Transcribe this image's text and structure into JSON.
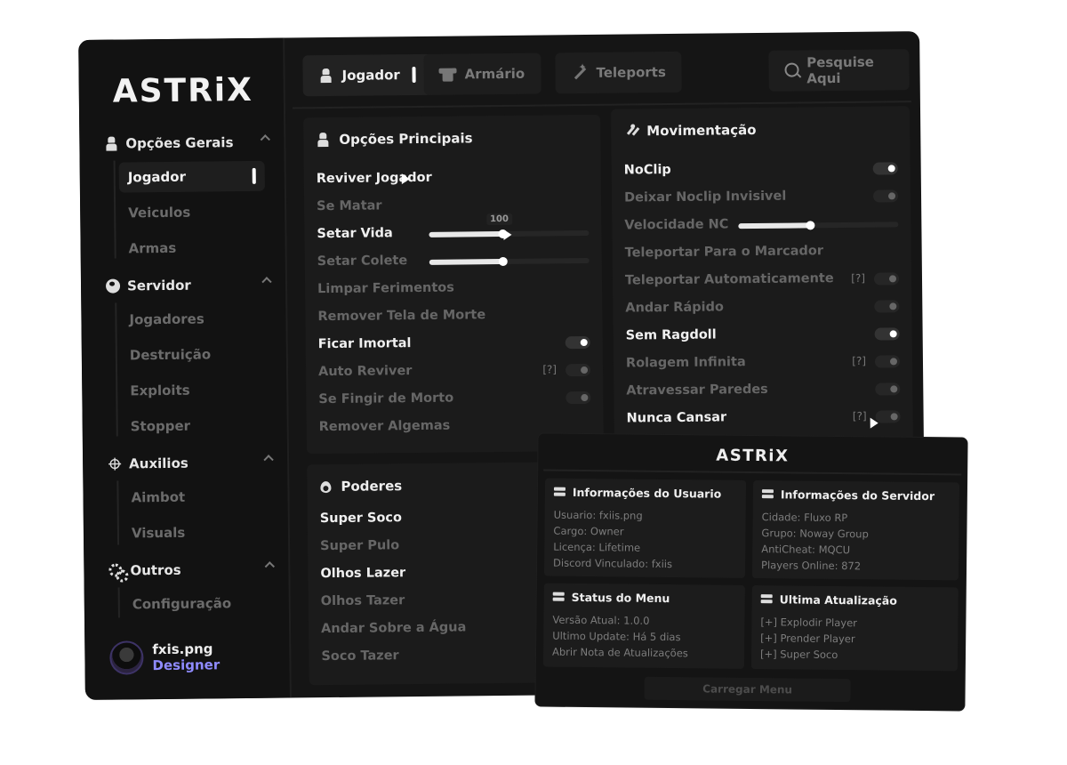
{
  "app": {
    "logo": "ASTRiX"
  },
  "sidebar": {
    "sections": [
      {
        "label": "Opções Gerais",
        "icon": "person-icon",
        "items": [
          "Jogador",
          "Veiculos",
          "Armas"
        ]
      },
      {
        "label": "Servidor",
        "icon": "globe-icon",
        "items": [
          "Jogadores",
          "Destruição",
          "Exploits",
          "Stopper"
        ]
      },
      {
        "label": "Auxilios",
        "icon": "crosshair-icon",
        "items": [
          "Aimbot",
          "Visuals"
        ]
      },
      {
        "label": "Outros",
        "icon": "gears-icon",
        "items": [
          "Configuração"
        ]
      }
    ],
    "active_item": "Jogador",
    "profile": {
      "name": "fxis.png",
      "role": "Designer"
    }
  },
  "tabs": [
    {
      "label": "Jogador",
      "icon": "person-icon",
      "active": true
    },
    {
      "label": "Armário",
      "icon": "shirt-icon",
      "active": false
    },
    {
      "label": "Teleports",
      "icon": "wand-icon",
      "active": false
    }
  ],
  "search": {
    "label": "Pesquise Aqui"
  },
  "panels": {
    "principais": {
      "title": "Opções Principais",
      "rows": [
        {
          "label": "Reviver Jogador",
          "on": true
        },
        {
          "label": "Se Matar",
          "on": false
        },
        {
          "label": "Setar Vida",
          "on": true,
          "slider": 0.46,
          "slider_value": "100"
        },
        {
          "label": "Setar Colete",
          "on": false,
          "slider": 0.46
        },
        {
          "label": "Limpar Ferimentos",
          "on": false
        },
        {
          "label": "Remover Tela de Morte",
          "on": false
        },
        {
          "label": "Ficar Imortal",
          "on": true,
          "toggle": true
        },
        {
          "label": "Auto Reviver",
          "on": false,
          "toggle": false,
          "help": "[?]"
        },
        {
          "label": "Se Fingir de Morto",
          "on": false,
          "toggle": false
        },
        {
          "label": "Remover Algemas",
          "on": false
        }
      ]
    },
    "movimentacao": {
      "title": "Movimentação",
      "rows": [
        {
          "label": "NoClip",
          "on": true,
          "toggle": true
        },
        {
          "label": "Deixar Noclip Invisivel",
          "on": false,
          "toggle": false
        },
        {
          "label": "Velocidade NC",
          "on": false,
          "slider": 0.45
        },
        {
          "label": "Teleportar Para o Marcador",
          "on": false
        },
        {
          "label": "Teleportar Automaticamente",
          "on": false,
          "toggle": false,
          "help": "[?]"
        },
        {
          "label": "Andar Rápido",
          "on": false,
          "toggle": false
        },
        {
          "label": "Sem Ragdoll",
          "on": true,
          "toggle": true
        },
        {
          "label": "Rolagem Infinita",
          "on": false,
          "toggle": false,
          "help": "[?]"
        },
        {
          "label": "Atravessar Paredes",
          "on": false,
          "toggle": false
        },
        {
          "label": "Nunca Cansar",
          "on": true,
          "toggle": false,
          "help": "[?]"
        }
      ]
    },
    "poderes": {
      "title": "Poderes",
      "rows": [
        {
          "label": "Super Soco",
          "on": true
        },
        {
          "label": "Super Pulo",
          "on": false
        },
        {
          "label": "Olhos Lazer",
          "on": true
        },
        {
          "label": "Olhos Tazer",
          "on": false
        },
        {
          "label": "Andar Sobre a Água",
          "on": false
        },
        {
          "label": "Soco Tazer",
          "on": false
        }
      ]
    }
  },
  "overlay": {
    "logo": "ASTRiX",
    "cards": {
      "usuario": {
        "title": "Informações do Usuario",
        "lines": [
          "Usuario: fxiis.png",
          "Cargo: Owner",
          "Licença: Lifetime",
          "Discord Vinculado: fxiis"
        ]
      },
      "servidor": {
        "title": "Informações do Servidor",
        "lines": [
          "Cidade: Fluxo RP",
          "Grupo: Noway Group",
          "AntiCheat: MQCU",
          "Players Online: 872"
        ]
      },
      "status": {
        "title": "Status do Menu",
        "lines": [
          "Versão Atual: 1.0.0",
          "Ultimo Update: Há 5 dias",
          "Abrir Nota de Atualizações"
        ]
      },
      "atualizacao": {
        "title": "Ultima Atualização",
        "lines": [
          "[+] Explodir Player",
          "[+] Prender Player",
          "[+] Super Soco"
        ]
      }
    },
    "button": "Carregar Menu"
  }
}
